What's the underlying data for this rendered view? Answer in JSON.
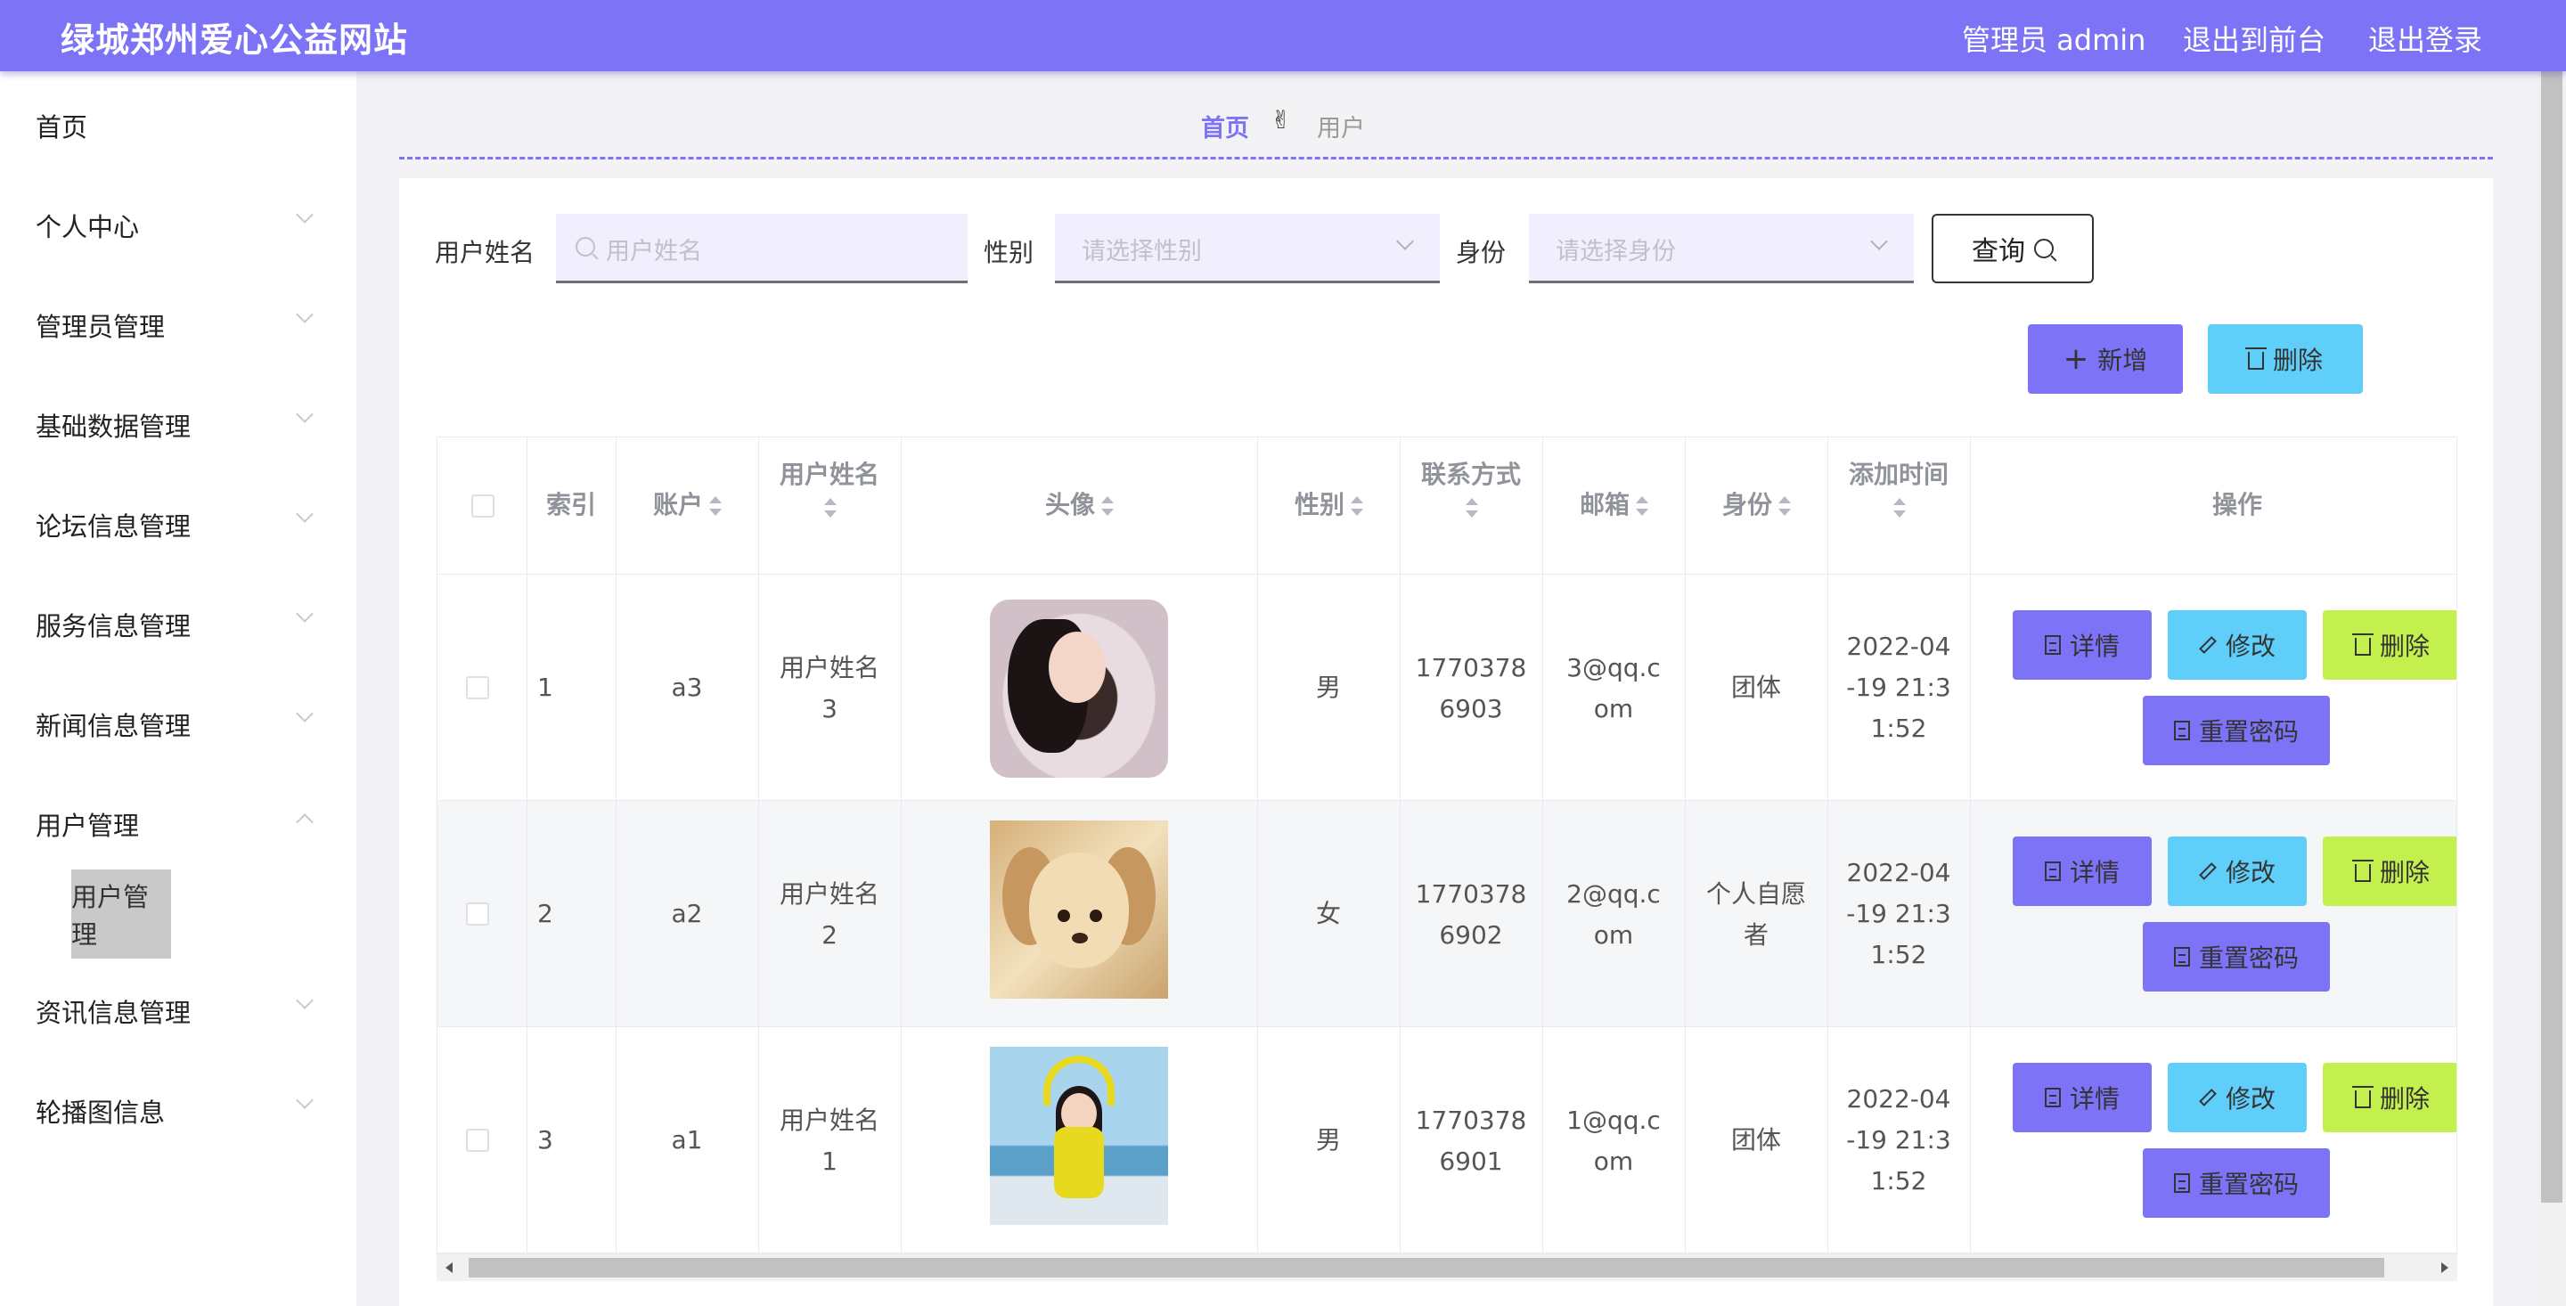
{
  "header": {
    "site_title": "绿城郑州爱心公益网站",
    "admin_label": "管理员 admin",
    "back_to_front": "退出到前台",
    "logout": "退出登录"
  },
  "sidebar": {
    "items": [
      {
        "label": "首页"
      },
      {
        "label": "个人中心"
      },
      {
        "label": "管理员管理"
      },
      {
        "label": "基础数据管理"
      },
      {
        "label": "论坛信息管理"
      },
      {
        "label": "服务信息管理"
      },
      {
        "label": "新闻信息管理"
      },
      {
        "label": "用户管理",
        "children": [
          "用户管理"
        ]
      },
      {
        "label": "资讯信息管理"
      },
      {
        "label": "轮播图信息"
      }
    ]
  },
  "breadcrumb": {
    "home": "首页",
    "separator": "✌",
    "current": "用户"
  },
  "filters": {
    "name_label": "用户姓名",
    "name_placeholder": "用户姓名",
    "gender_label": "性别",
    "gender_placeholder": "请选择性别",
    "identity_label": "身份",
    "identity_placeholder": "请选择身份",
    "query_button": "查询"
  },
  "toolbar": {
    "add_button": "新增",
    "delete_button": "删除"
  },
  "table": {
    "columns": [
      "索引",
      "账户",
      "用户姓名",
      "头像",
      "性别",
      "联系方式",
      "邮箱",
      "身份",
      "添加时间",
      "操作"
    ],
    "rows": [
      {
        "index": "1",
        "account": "a3",
        "name_l1": "用户姓名",
        "name_l2": "3",
        "avatar": "woman-portrait-pillow",
        "gender": "男",
        "phone_l1": "1770378",
        "phone_l2": "6903",
        "email_l1": "3@qq.c",
        "email_l2": "om",
        "identity_l1": "团体",
        "identity_l2": "",
        "time_l1": "2022-04",
        "time_l2": "-19 21:3",
        "time_l3": "1:52"
      },
      {
        "index": "2",
        "account": "a2",
        "name_l1": "用户姓名",
        "name_l2": "2",
        "avatar": "puppy-photo",
        "gender": "女",
        "phone_l1": "1770378",
        "phone_l2": "6902",
        "email_l1": "2@qq.c",
        "email_l2": "om",
        "identity_l1": "个人自愿",
        "identity_l2": "者",
        "time_l1": "2022-04",
        "time_l2": "-19 21:3",
        "time_l3": "1:52"
      },
      {
        "index": "3",
        "account": "a1",
        "name_l1": "用户姓名",
        "name_l2": "1",
        "avatar": "girl-beach-photo",
        "gender": "男",
        "phone_l1": "1770378",
        "phone_l2": "6901",
        "email_l1": "1@qq.c",
        "email_l2": "om",
        "identity_l1": "团体",
        "identity_l2": "",
        "time_l1": "2022-04",
        "time_l2": "-19 21:3",
        "time_l3": "1:52"
      }
    ],
    "actions": {
      "detail": "详情",
      "edit": "修改",
      "delete": "删除",
      "reset_password": "重置密码"
    }
  },
  "colors": {
    "primary": "#7c73f6",
    "info": "#5fcffa",
    "warning": "#c4f04e"
  }
}
